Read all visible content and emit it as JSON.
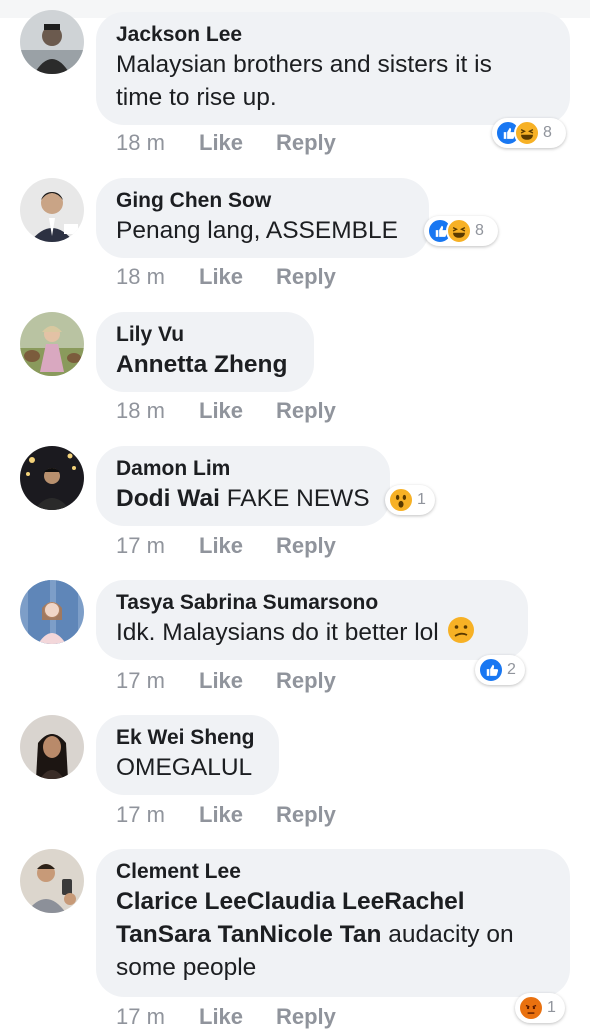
{
  "comments": [
    {
      "author": "Jackson Lee",
      "text_lines": [
        "Malaysian brothers and sisters it is",
        "time to rise up."
      ],
      "time": "18 m",
      "like": "Like",
      "reply": "Reply",
      "reactions": {
        "icons": [
          "like-icon",
          "haha-icon"
        ],
        "count": "8"
      }
    },
    {
      "author": "Ging Chen Sow",
      "text": "Penang lang, ASSEMBLE",
      "time": "18 m",
      "like": "Like",
      "reply": "Reply",
      "reactions": {
        "icons": [
          "like-icon",
          "haha-icon"
        ],
        "count": "8"
      }
    },
    {
      "author": "Lily Vu",
      "mention": "Annetta Zheng",
      "time": "18 m",
      "like": "Like",
      "reply": "Reply"
    },
    {
      "author": "Damon Lim",
      "mention": "Dodi Wai",
      "text": " FAKE NEWS",
      "time": "17 m",
      "like": "Like",
      "reply": "Reply",
      "reactions": {
        "icons": [
          "wow-icon"
        ],
        "count": "1"
      }
    },
    {
      "author": "Tasya Sabrina Sumarsono",
      "text": "Idk. Malaysians do it better lol",
      "emoji": "confused-face-icon",
      "time": "17 m",
      "like": "Like",
      "reply": "Reply",
      "reactions": {
        "icons": [
          "like-icon"
        ],
        "count": "2"
      }
    },
    {
      "author": "Ek Wei Sheng",
      "text": "OMEGALUL",
      "time": "17 m",
      "like": "Like",
      "reply": "Reply"
    },
    {
      "author": "Clement Lee",
      "mentions_line1": "Clarice LeeClaudia LeeRachel",
      "mentions_line2": "TanSara TanNicole Tan",
      "text_line2": " audacity on",
      "text_line3": "some people",
      "time": "17 m",
      "like": "Like",
      "reply": "Reply",
      "reactions": {
        "icons": [
          "angry-icon"
        ],
        "count": "1"
      }
    }
  ],
  "colors": {
    "bubble": "#f0f2f5",
    "meta": "#90949c",
    "like_blue": "#1877f2",
    "haha_yellow": "#f7b125",
    "angry_orange": "#e9710f"
  }
}
